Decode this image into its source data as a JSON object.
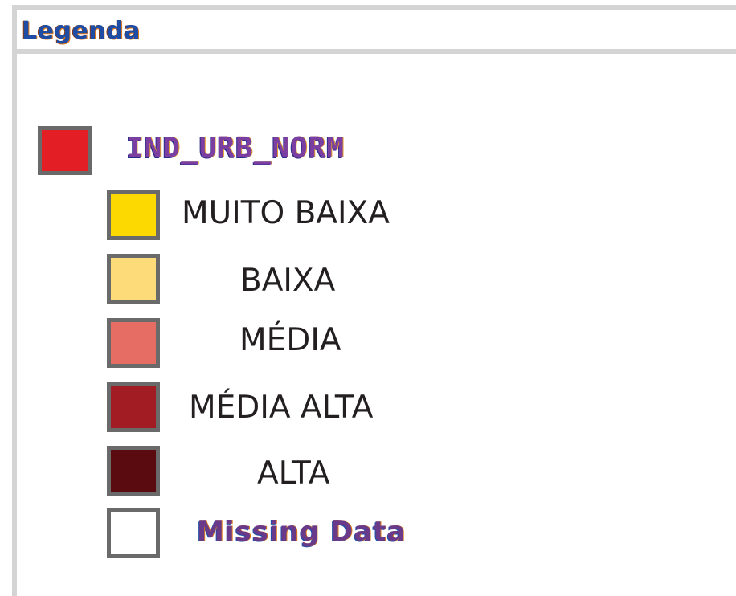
{
  "legend": {
    "title": "Legenda",
    "layer": {
      "name": "IND_URB_NORM",
      "color": "#e31e24"
    },
    "classes": [
      {
        "label": "MUITO BAIXA",
        "color": "#fcd900"
      },
      {
        "label": "BAIXA",
        "color": "#fddb78"
      },
      {
        "label": "MÉDIA",
        "color": "#e56d64"
      },
      {
        "label": "MÉDIA ALTA",
        "color": "#a21c23"
      },
      {
        "label": "ALTA",
        "color": "#5a0b10"
      }
    ],
    "missing": {
      "label": "Missing Data",
      "color": "#ffffff"
    },
    "swatch_border_color": "#6a6a6a"
  }
}
